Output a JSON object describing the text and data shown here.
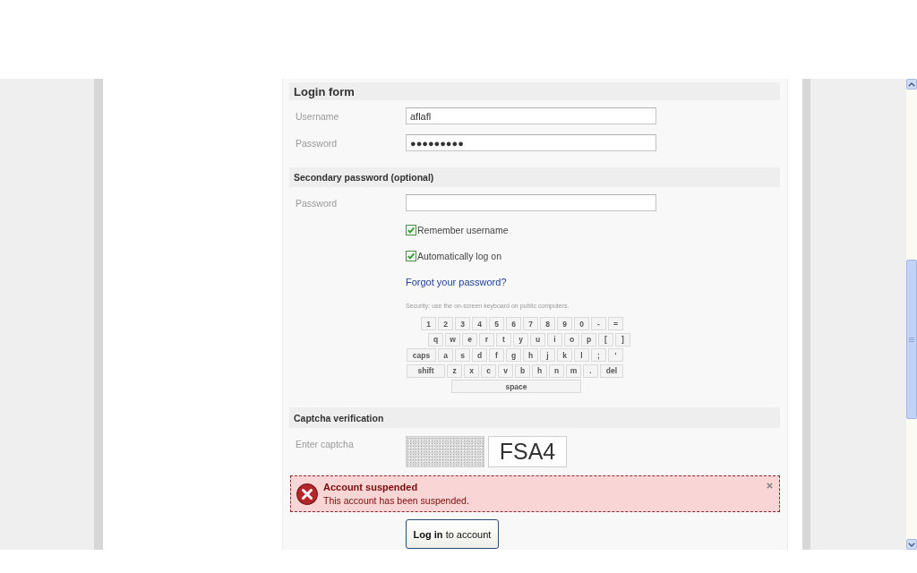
{
  "form": {
    "sections": [
      {
        "kind": "title",
        "heading": "Login form",
        "fields": [
          {
            "label": "Username",
            "value": "aflafl"
          },
          {
            "label": "Password",
            "value": "●●●●●●●●●"
          }
        ]
      },
      {
        "kind": "subtitle",
        "heading": "Secondary password (optional)",
        "fields": [
          {
            "label": "Password"
          }
        ]
      }
    ],
    "options": [
      {
        "label": "Remember username",
        "checked": true
      },
      {
        "label": "Automatically log on",
        "checked": true
      }
    ],
    "forgot_link": "Forgot your password?",
    "keyboard": {
      "note": "Security: use the on-screen keyboard on public computers.",
      "rows": [
        [
          {
            "label": "1",
            "kind": "char"
          },
          {
            "label": "2",
            "kind": "char"
          },
          {
            "label": "3",
            "kind": "char"
          },
          {
            "label": "4",
            "kind": "char"
          },
          {
            "label": "5",
            "kind": "char"
          },
          {
            "label": "6",
            "kind": "char"
          },
          {
            "label": "7",
            "kind": "char"
          },
          {
            "label": "8",
            "kind": "char"
          },
          {
            "label": "9",
            "kind": "char"
          },
          {
            "label": "0",
            "kind": "char"
          },
          {
            "label": "-",
            "kind": "char"
          },
          {
            "label": "=",
            "kind": "char"
          }
        ],
        [
          {
            "label": "q",
            "kind": "char"
          },
          {
            "label": "w",
            "kind": "char"
          },
          {
            "label": "e",
            "kind": "char"
          },
          {
            "label": "r",
            "kind": "char"
          },
          {
            "label": "t",
            "kind": "char"
          },
          {
            "label": "y",
            "kind": "char"
          },
          {
            "label": "u",
            "kind": "char"
          },
          {
            "label": "i",
            "kind": "char"
          },
          {
            "label": "o",
            "kind": "char"
          },
          {
            "label": "p",
            "kind": "char"
          },
          {
            "label": "[",
            "kind": "char"
          },
          {
            "label": "]",
            "kind": "char"
          }
        ],
        [
          {
            "label": "caps",
            "kind": "wide"
          },
          {
            "label": "a",
            "kind": "char"
          },
          {
            "label": "s",
            "kind": "char"
          },
          {
            "label": "d",
            "kind": "char"
          },
          {
            "label": "f",
            "kind": "char"
          },
          {
            "label": "g",
            "kind": "char"
          },
          {
            "label": "h",
            "kind": "char"
          },
          {
            "label": "j",
            "kind": "char"
          },
          {
            "label": "k",
            "kind": "char"
          },
          {
            "label": "l",
            "kind": "char"
          },
          {
            "label": ";",
            "kind": "char"
          },
          {
            "label": "'",
            "kind": "char"
          }
        ],
        [
          {
            "label": "shift",
            "kind": "wider"
          },
          {
            "label": "z",
            "kind": "char"
          },
          {
            "label": "x",
            "kind": "char"
          },
          {
            "label": "c",
            "kind": "char"
          },
          {
            "label": "v",
            "kind": "char"
          },
          {
            "label": "b",
            "kind": "char"
          },
          {
            "label": "h",
            "kind": "char"
          },
          {
            "label": "n",
            "kind": "char"
          },
          {
            "label": "m",
            "kind": "char"
          },
          {
            "label": ".",
            "kind": "char"
          },
          {
            "label": "del",
            "kind": "medium"
          }
        ]
      ],
      "space_key": "space"
    },
    "captcha": {
      "heading": "Captcha verification",
      "label": "Enter captcha",
      "value": "FSA4"
    },
    "alert": {
      "title": "Account suspended",
      "message": "This account has been suspended."
    },
    "submit": "**Log in** to account"
  }
}
